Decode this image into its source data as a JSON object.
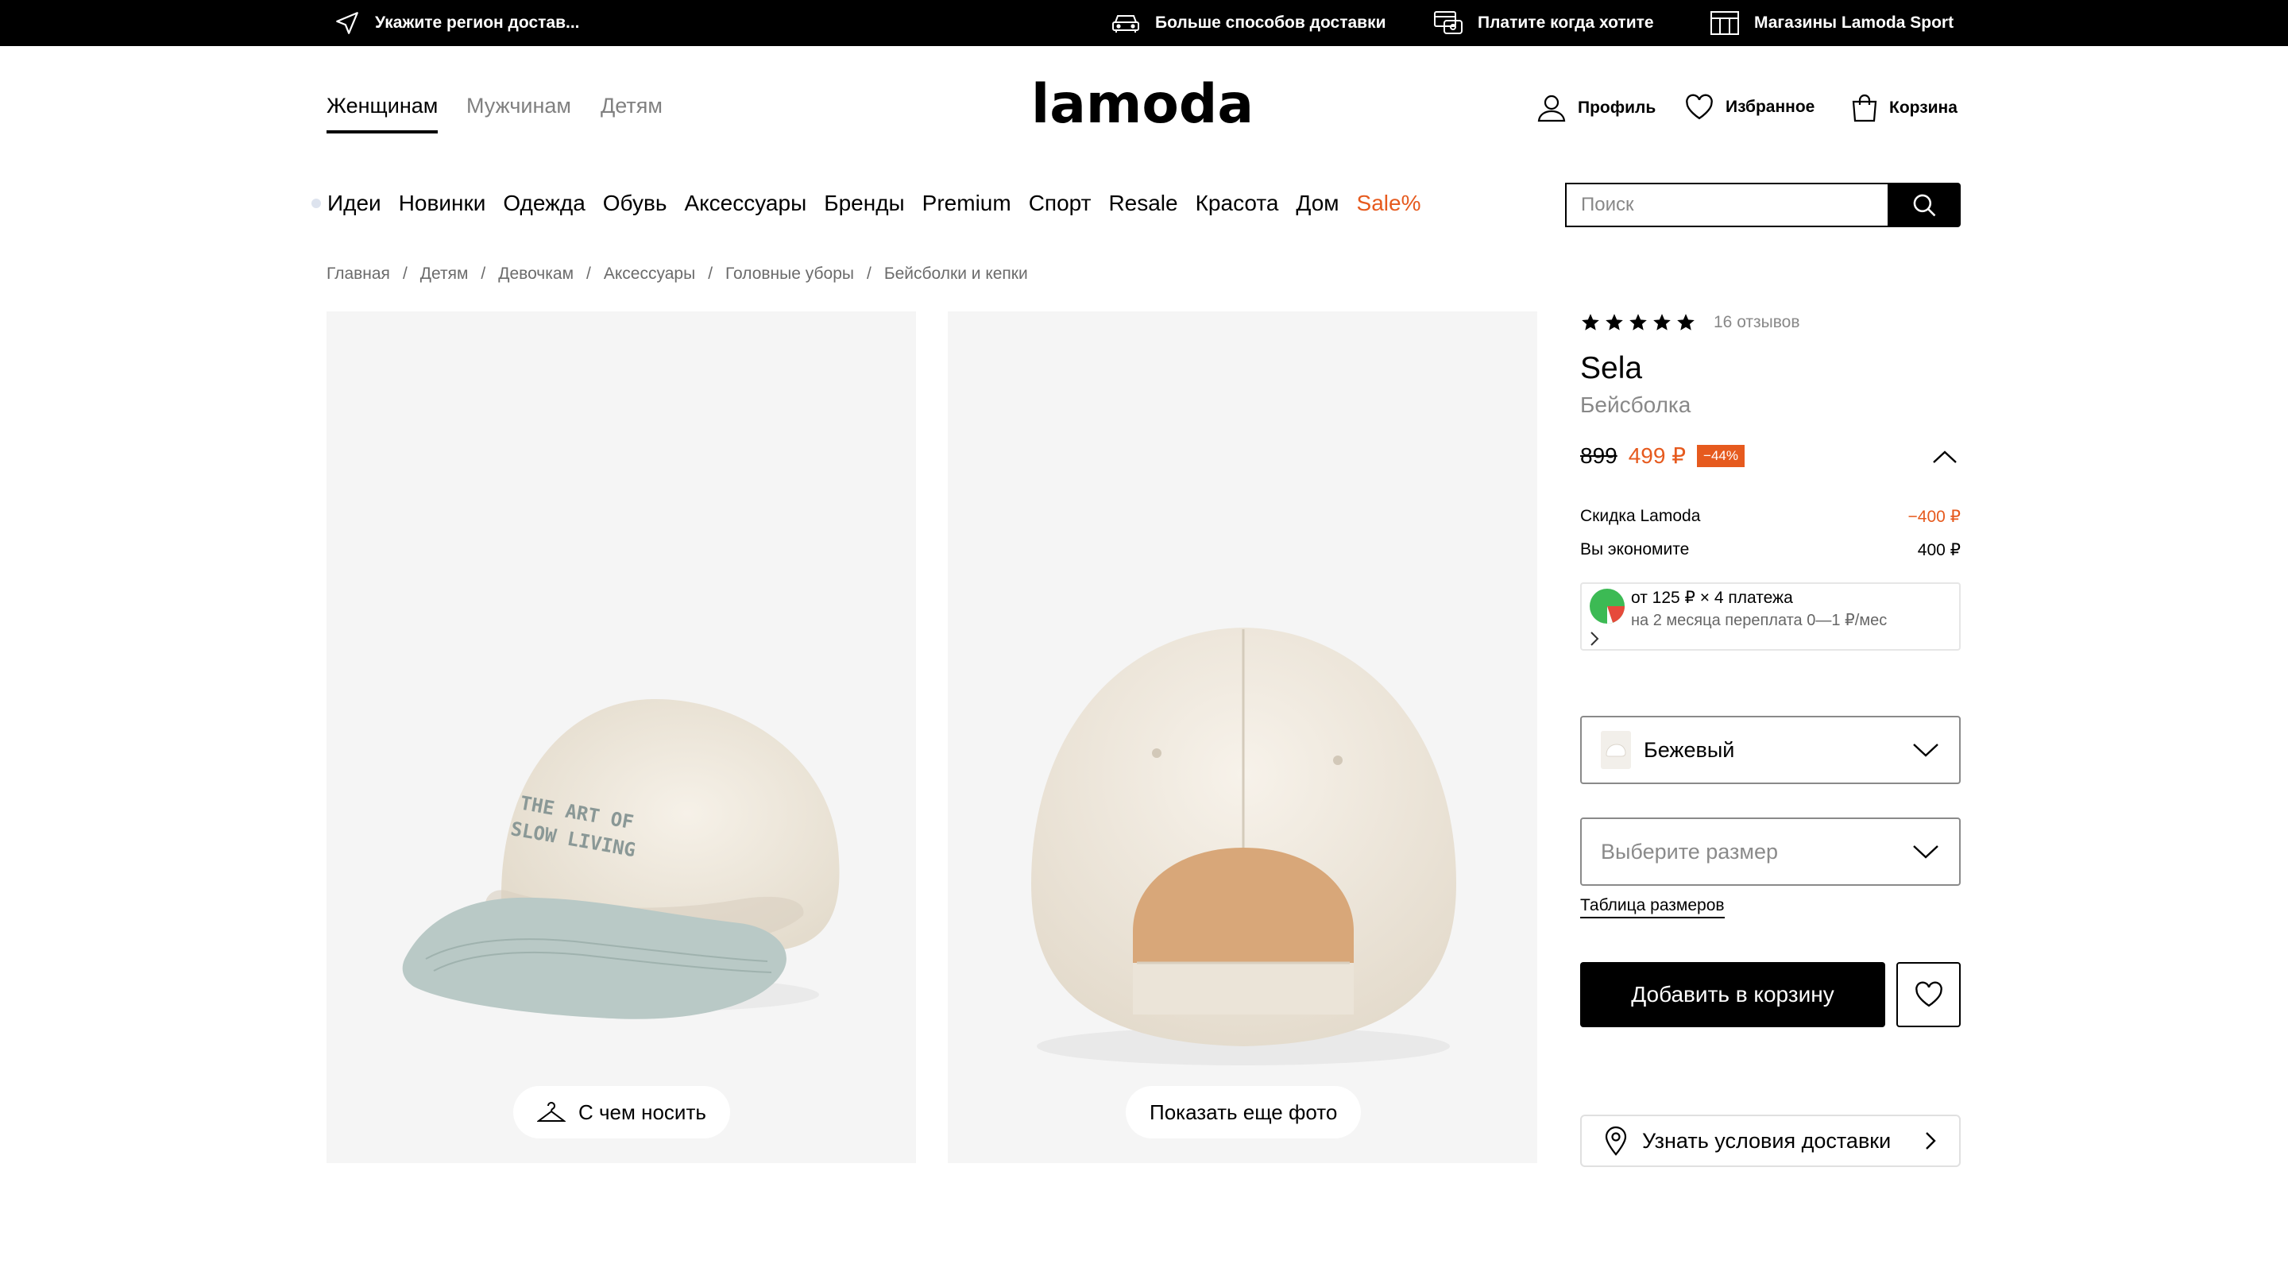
{
  "topbar": {
    "region": "Укажите регион достав...",
    "delivery_ways": "Больше способов доставки",
    "pay_later": "Платите когда хотите",
    "stores": "Магазины Lamoda Sport"
  },
  "header": {
    "genders": [
      "Женщинам",
      "Мужчинам",
      "Детям"
    ],
    "logo": "lamoda",
    "profile": "Профиль",
    "favorites": "Избранное",
    "cart": "Корзина"
  },
  "nav": {
    "categories": [
      "Идеи",
      "Новинки",
      "Одежда",
      "Обувь",
      "Аксессуары",
      "Бренды",
      "Premium",
      "Спорт",
      "Resale",
      "Красота",
      "Дом",
      "Sale%"
    ],
    "search_placeholder": "Поиск"
  },
  "breadcrumb": [
    "Главная",
    "Детям",
    "Девочкам",
    "Аксессуары",
    "Головные уборы",
    "Бейсболки и кепки"
  ],
  "gallery": {
    "front_print": "THE ART OF SLOW LIVING",
    "outfit_button": "С чем носить",
    "more_photos_button": "Показать еще фото"
  },
  "product": {
    "rating": 5,
    "reviews": "16 отзывов",
    "brand": "Sela",
    "type": "Бейсболка",
    "old_price": "899",
    "new_price": "499 ₽",
    "discount_badge": "−44%",
    "lamoda_discount_label": "Скидка Lamoda",
    "lamoda_discount_value": "−400 ₽",
    "savings_label": "Вы экономите",
    "savings_value": "400 ₽",
    "installment_main": "от 125 ₽ × 4 платежа",
    "installment_sub": "на 2 месяца переплата 0—1 ₽/мес",
    "color": "Бежевый",
    "size_placeholder": "Выберите размер",
    "size_table": "Таблица размеров",
    "add_to_cart": "Добавить в корзину",
    "delivery": "Узнать условия доставки"
  },
  "colors": {
    "accent": "#e65a1e",
    "gallery_bg": "#f5f5f5",
    "cap_body": "#efe8dc",
    "cap_visor": "#b9c9c6"
  }
}
